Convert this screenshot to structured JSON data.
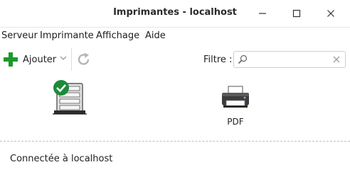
{
  "window": {
    "title": "Imprimantes - localhost"
  },
  "menubar": {
    "items": [
      "Serveur",
      "Imprimante",
      "Affichage",
      "Aide"
    ]
  },
  "toolbar": {
    "add_label": "Ajouter",
    "filter_label": "Filtre :",
    "filter_value": "",
    "filter_placeholder": ""
  },
  "printers": [
    {
      "name": "",
      "status": "default"
    },
    {
      "name": "PDF"
    }
  ],
  "statusbar": {
    "text": "Connectée à localhost"
  },
  "colors": {
    "accent_green": "#1a9a2a",
    "check_green": "#1d8a3a"
  }
}
